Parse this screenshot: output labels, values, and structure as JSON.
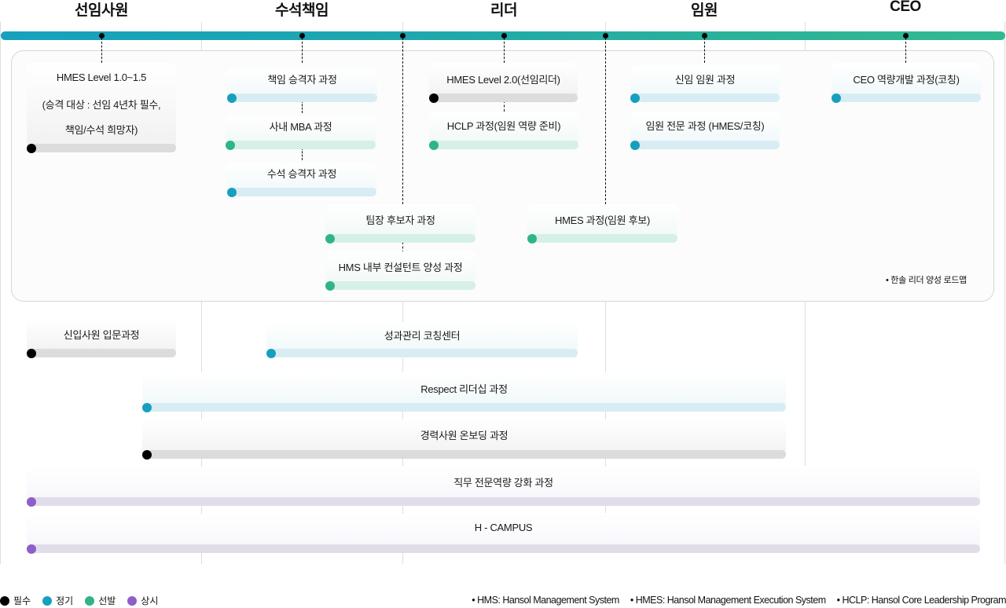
{
  "stages": [
    {
      "title": "선임사원"
    },
    {
      "title": "수석책임"
    },
    {
      "title": "리더"
    },
    {
      "title": "임원"
    },
    {
      "title": "CEO"
    }
  ],
  "colors": {
    "required": "#000000",
    "regular": "#179fbe",
    "selective": "#2fb48a",
    "always": "#8e5ec9",
    "track_start": "#17a1bd",
    "track_end": "#33b991"
  },
  "leader_roadmap_note": "• 한솔 리더 양성 로드맵",
  "courses": [
    {
      "id": "hmes-1",
      "type": "required",
      "lines": [
        "HMES Level 1.0~1.5",
        "(승격 대상 : 선임 4년차 필수,",
        "책임/수석 희망자)"
      ]
    },
    {
      "id": "chaekim",
      "type": "regular",
      "lines": [
        "책임 승격자 과정"
      ]
    },
    {
      "id": "mba",
      "type": "selective",
      "lines": [
        "사내 MBA 과정"
      ]
    },
    {
      "id": "suseok",
      "type": "regular",
      "lines": [
        "수석 승격자 과정"
      ]
    },
    {
      "id": "teamlead",
      "type": "selective",
      "lines": [
        "팀장 후보자 과정"
      ]
    },
    {
      "id": "hms-consult",
      "type": "selective",
      "lines": [
        "HMS 내부 컨설턴트 양성 과정"
      ]
    },
    {
      "id": "hmes-2",
      "type": "required",
      "lines": [
        "HMES Level 2.0(선임리더)"
      ]
    },
    {
      "id": "hclp",
      "type": "selective",
      "lines": [
        "HCLP 과정(임원 역량 준비)"
      ]
    },
    {
      "id": "hmes-exec",
      "type": "selective",
      "lines": [
        "HMES 과정(임원 후보)"
      ]
    },
    {
      "id": "new-exec",
      "type": "regular",
      "lines": [
        "신임 임원 과정"
      ]
    },
    {
      "id": "exec-expert",
      "type": "regular",
      "lines": [
        "임원 전문 과정 (HMES/코칭)"
      ]
    },
    {
      "id": "ceo",
      "type": "regular",
      "lines": [
        "CEO 역량개발 과정(코칭)"
      ]
    },
    {
      "id": "intro",
      "type": "required",
      "lines": [
        "신입사원 입문과정"
      ]
    },
    {
      "id": "coaching",
      "type": "regular",
      "lines": [
        "성과관리 코칭센터"
      ]
    },
    {
      "id": "respect",
      "type": "regular",
      "lines": [
        "Respect 리더십 과정"
      ]
    },
    {
      "id": "onboarding",
      "type": "required",
      "lines": [
        "경력사원 온보딩 과정"
      ]
    },
    {
      "id": "job",
      "type": "always",
      "lines": [
        "직무 전문역량 강화 과정"
      ]
    },
    {
      "id": "hcampus",
      "type": "always",
      "lines": [
        "H - CAMPUS"
      ]
    }
  ],
  "legend": [
    {
      "label": "필수",
      "type": "required"
    },
    {
      "label": "정기",
      "type": "regular"
    },
    {
      "label": "선발",
      "type": "selective"
    },
    {
      "label": "상시",
      "type": "always"
    }
  ],
  "abbreviations": [
    "• HMS: Hansol Management System",
    "• HMES: Hansol Management Execution System",
    "• HCLP: Hansol Core Leadership Program"
  ]
}
